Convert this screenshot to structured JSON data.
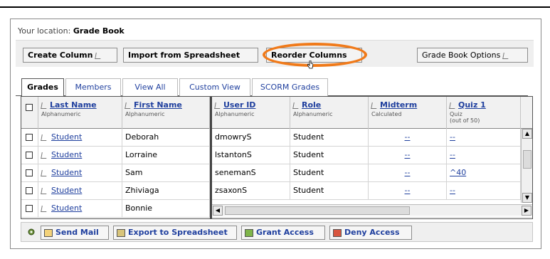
{
  "breadcrumb": {
    "prefix": "Your location:",
    "current": "Grade Book"
  },
  "toolbar": {
    "create_column": "Create Column",
    "import_spreadsheet": "Import from Spreadsheet",
    "reorder_columns": "Reorder Columns",
    "grade_book_options": "Grade Book Options",
    "highlight_color": "#f07a1a"
  },
  "tabs": [
    {
      "label": "Grades",
      "active": true
    },
    {
      "label": "Members",
      "active": false
    },
    {
      "label": "View All",
      "active": false
    },
    {
      "label": "Custom View",
      "active": false
    },
    {
      "label": "SCORM Grades",
      "active": false
    }
  ],
  "columns": [
    {
      "title": "Last Name",
      "sub": "Alphanumeric"
    },
    {
      "title": "First Name",
      "sub": "Alphanumeric"
    },
    {
      "title": "User ID",
      "sub": "Alphanumeric"
    },
    {
      "title": "Role",
      "sub": "Alphanumeric"
    },
    {
      "title": "Midterm",
      "sub": "Calculated"
    },
    {
      "title": "Quiz 1",
      "sub": "Quiz",
      "sub2": "(out of 50)"
    }
  ],
  "rows": [
    {
      "last": "Student",
      "first": "Deborah",
      "user_id": "dmowryS",
      "role": "Student",
      "midterm": "--",
      "quiz1": "--"
    },
    {
      "last": "Student",
      "first": "Lorraine",
      "user_id": "lstantonS",
      "role": "Student",
      "midterm": "--",
      "quiz1": "--"
    },
    {
      "last": "Student",
      "first": "Sam",
      "user_id": "senemanS",
      "role": "Student",
      "midterm": "--",
      "quiz1": "^40"
    },
    {
      "last": "Student",
      "first": "Zhiviaga",
      "user_id": "zsaxonS",
      "role": "Student",
      "midterm": "--",
      "quiz1": "--"
    },
    {
      "last": "Student",
      "first": "Bonnie",
      "user_id": "",
      "role": "",
      "midterm": "",
      "quiz1": ""
    }
  ],
  "actions": {
    "send_mail": "Send Mail",
    "export_spreadsheet": "Export to Spreadsheet",
    "grant_access": "Grant Access",
    "deny_access": "Deny Access"
  },
  "icons": {
    "sort": "sort-icon",
    "gear": "gear-icon",
    "mail": "mail-icon",
    "export": "export-icon",
    "grant": "grant-access-icon",
    "deny": "deny-access-icon"
  }
}
